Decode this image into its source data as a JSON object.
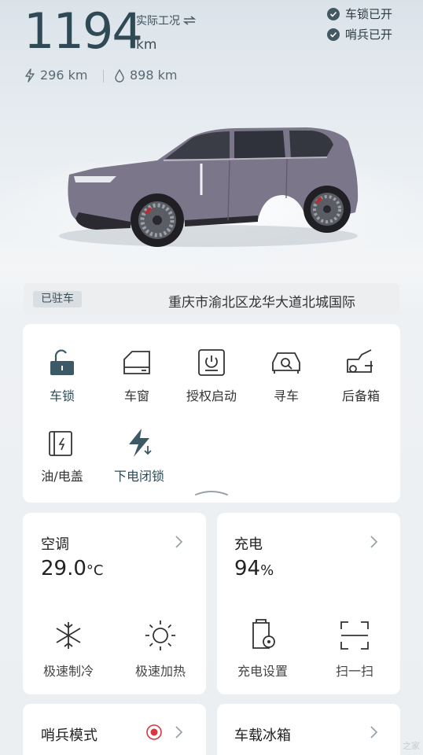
{
  "header": {
    "range_value": "1194",
    "range_unit": "km",
    "mode_label": "实际工况",
    "electric_range": "296 km",
    "fuel_range": "898 km",
    "status": [
      {
        "label": "车锁已开"
      },
      {
        "label": "哨兵已开"
      }
    ]
  },
  "location": {
    "parked_tag": "已驻车",
    "address": "重庆市渝北区龙华大道北城国际"
  },
  "controls": [
    {
      "label": "车锁",
      "icon": "unlock-icon",
      "active": true
    },
    {
      "label": "车窗",
      "icon": "car-window-icon"
    },
    {
      "label": "授权启动",
      "icon": "power-start-icon"
    },
    {
      "label": "寻车",
      "icon": "find-car-icon"
    },
    {
      "label": "后备箱",
      "icon": "trunk-icon"
    },
    {
      "label": "油/电盖",
      "icon": "fuel-charge-cap-icon"
    },
    {
      "label": "下电闭锁",
      "icon": "power-off-lock-icon",
      "active": true
    }
  ],
  "ac": {
    "title": "空调",
    "temp_value": "29.0",
    "temp_unit": "°C",
    "quick_cool": "极速制冷",
    "quick_heat": "极速加热"
  },
  "charging": {
    "title": "充电",
    "percent_value": "94",
    "percent_unit": "%",
    "settings_label": "充电设置",
    "scan_label": "扫一扫"
  },
  "sentry": {
    "title": "哨兵模式"
  },
  "fridge": {
    "title": "车载冰箱"
  },
  "watermark": "之家",
  "colors": {
    "accent": "#2f4a55",
    "active_icon": "#3c5a66",
    "sentry_red": "#d9363e",
    "car_body": "#7b7689"
  }
}
